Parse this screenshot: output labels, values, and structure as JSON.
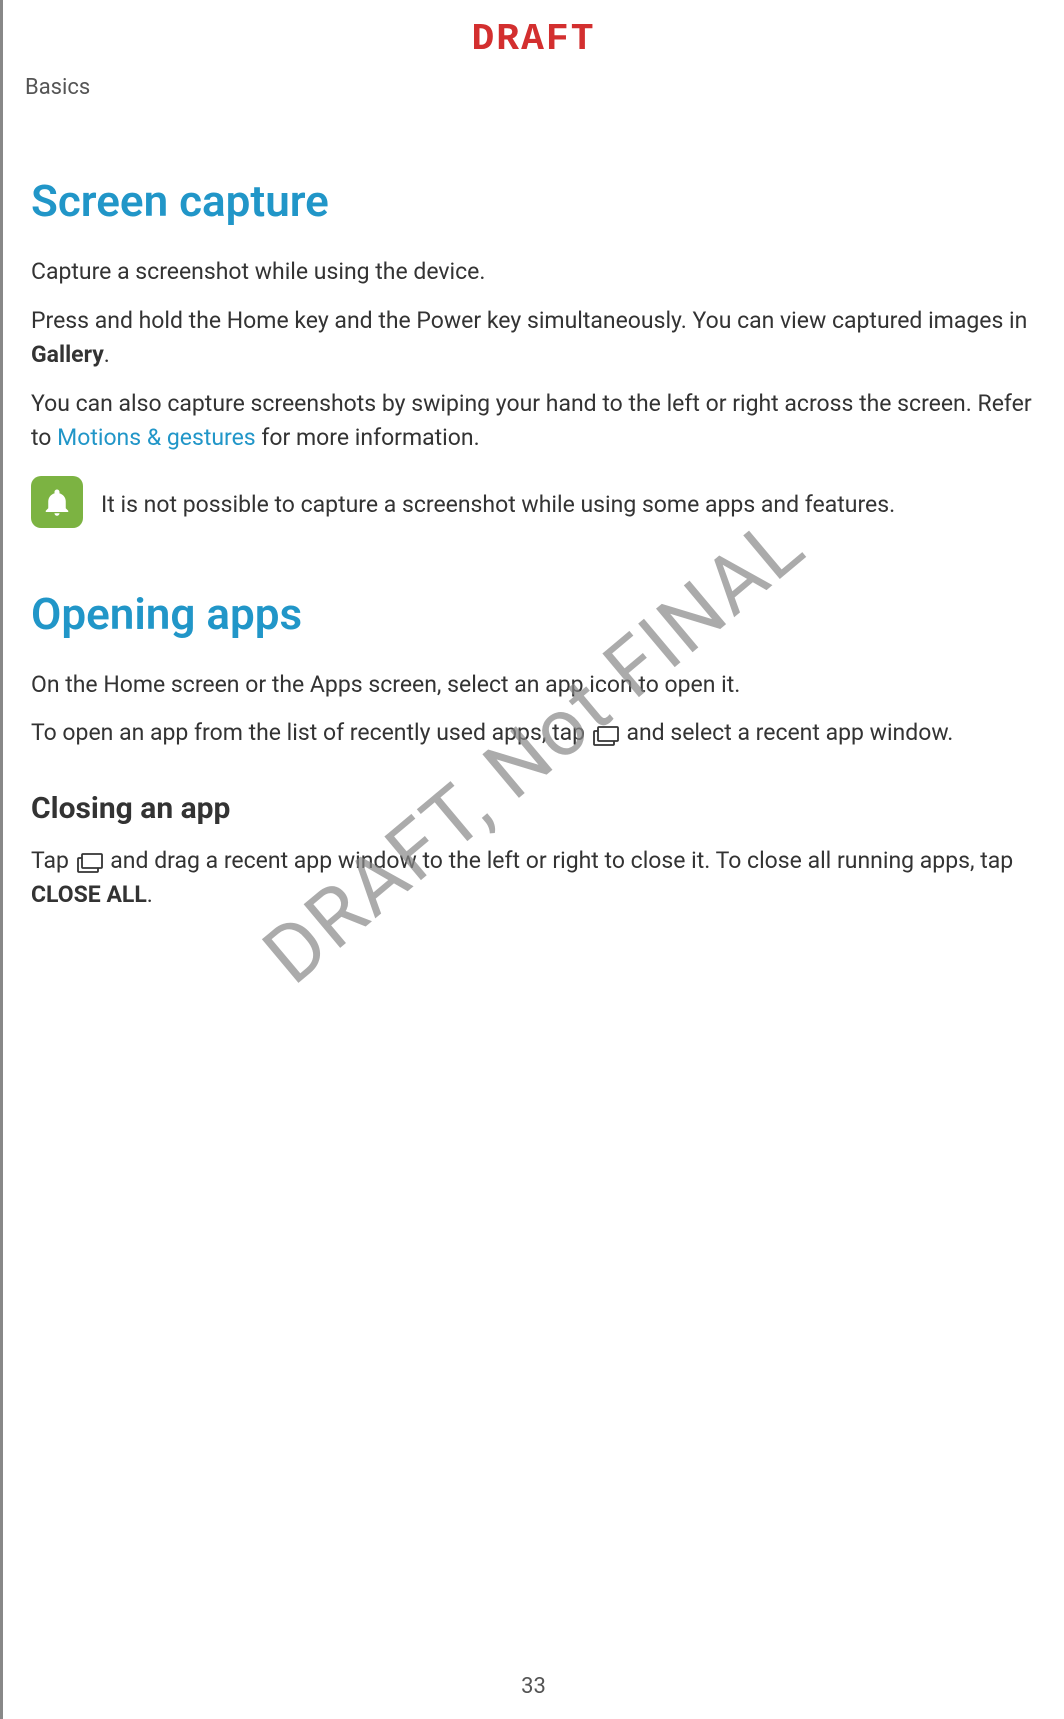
{
  "header": {
    "draft_label": "DRAFT",
    "section_label": "Basics"
  },
  "watermark": "DRAFT, Not FINAL",
  "page_number": "33",
  "sections": {
    "screen_capture": {
      "title": "Screen capture",
      "p1": "Capture a screenshot while using the device.",
      "p2_pre": "Press and hold the Home key and the Power key simultaneously. You can view captured images in ",
      "p2_bold": "Gallery",
      "p2_post": ".",
      "p3_pre": "You can also capture screenshots by swiping your hand to the left or right across the screen. Refer to ",
      "p3_link": "Motions & gestures",
      "p3_post": " for more information.",
      "note": "It is not possible to capture a screenshot while using some apps and features."
    },
    "opening_apps": {
      "title": "Opening apps",
      "p1": "On the Home screen or the Apps screen, select an app icon to open it.",
      "p2_pre": "To open an app from the list of recently used apps, tap ",
      "p2_post": " and select a recent app window.",
      "subtitle": "Closing an app",
      "p3_pre": "Tap ",
      "p3_mid": " and drag a recent app window to the left or right to close it. To close all running apps, tap ",
      "p3_bold": "CLOSE ALL",
      "p3_post": "."
    }
  }
}
